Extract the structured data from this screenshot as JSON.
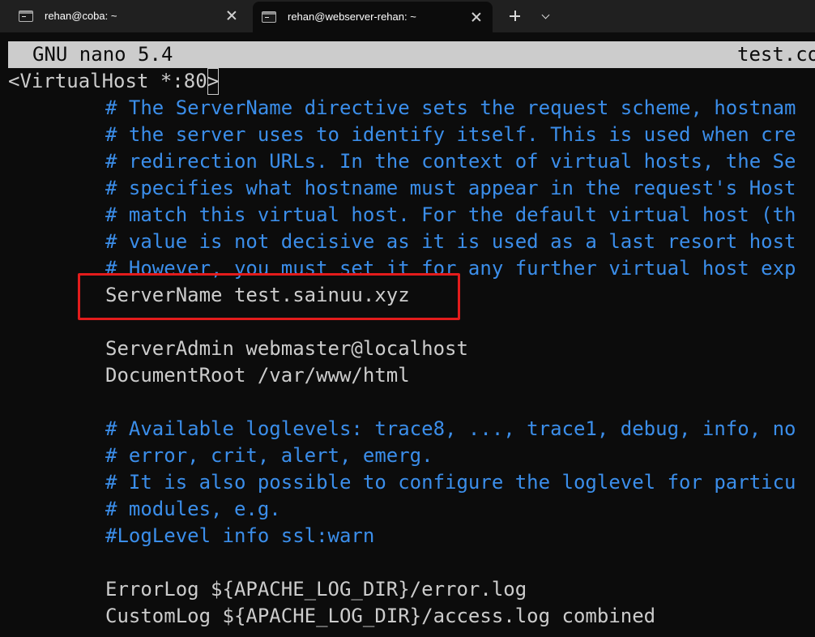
{
  "tabs": [
    {
      "title": "rehan@coba: ~",
      "active": false
    },
    {
      "title": "rehan@webserver-rehan: ~",
      "active": true
    }
  ],
  "nano": {
    "app_title": "GNU nano 5.4",
    "file_name": "test.co"
  },
  "lines": [
    {
      "type": "plain",
      "indent": 0,
      "text": "<VirtualHost *:80>"
    },
    {
      "type": "comment",
      "indent": 1,
      "text": "# The ServerName directive sets the request scheme, hostnam"
    },
    {
      "type": "comment",
      "indent": 1,
      "text": "# the server uses to identify itself. This is used when cre"
    },
    {
      "type": "comment",
      "indent": 1,
      "text": "# redirection URLs. In the context of virtual hosts, the Se"
    },
    {
      "type": "comment",
      "indent": 1,
      "text": "# specifies what hostname must appear in the request's Host"
    },
    {
      "type": "comment",
      "indent": 1,
      "text": "# match this virtual host. For the default virtual host (th"
    },
    {
      "type": "comment",
      "indent": 1,
      "text": "# value is not decisive as it is used as a last resort host"
    },
    {
      "type": "comment",
      "indent": 1,
      "text": "# However, you must set it for any further virtual host exp"
    },
    {
      "type": "plain",
      "indent": 1,
      "text": "ServerName test.sainuu.xyz"
    },
    {
      "type": "plain",
      "indent": 1,
      "text": ""
    },
    {
      "type": "plain",
      "indent": 1,
      "text": "ServerAdmin webmaster@localhost"
    },
    {
      "type": "plain",
      "indent": 1,
      "text": "DocumentRoot /var/www/html"
    },
    {
      "type": "plain",
      "indent": 1,
      "text": ""
    },
    {
      "type": "comment",
      "indent": 1,
      "text": "# Available loglevels: trace8, ..., trace1, debug, info, no"
    },
    {
      "type": "comment",
      "indent": 1,
      "text": "# error, crit, alert, emerg."
    },
    {
      "type": "comment",
      "indent": 1,
      "text": "# It is also possible to configure the loglevel for particu"
    },
    {
      "type": "comment",
      "indent": 1,
      "text": "# modules, e.g."
    },
    {
      "type": "comment",
      "indent": 1,
      "text": "#LogLevel info ssl:warn"
    },
    {
      "type": "plain",
      "indent": 1,
      "text": ""
    },
    {
      "type": "plain",
      "indent": 1,
      "text": "ErrorLog ${APACHE_LOG_DIR}/error.log"
    },
    {
      "type": "plain",
      "indent": 1,
      "text": "CustomLog ${APACHE_LOG_DIR}/access.log combined"
    }
  ],
  "colors": {
    "comment": "#3b8eea",
    "text": "#cccccc",
    "background": "#0c0c0c",
    "highlight_box": "#e31c1c"
  },
  "icons": [
    "terminal-icon",
    "close-icon",
    "plus-icon",
    "chevron-down-icon"
  ]
}
